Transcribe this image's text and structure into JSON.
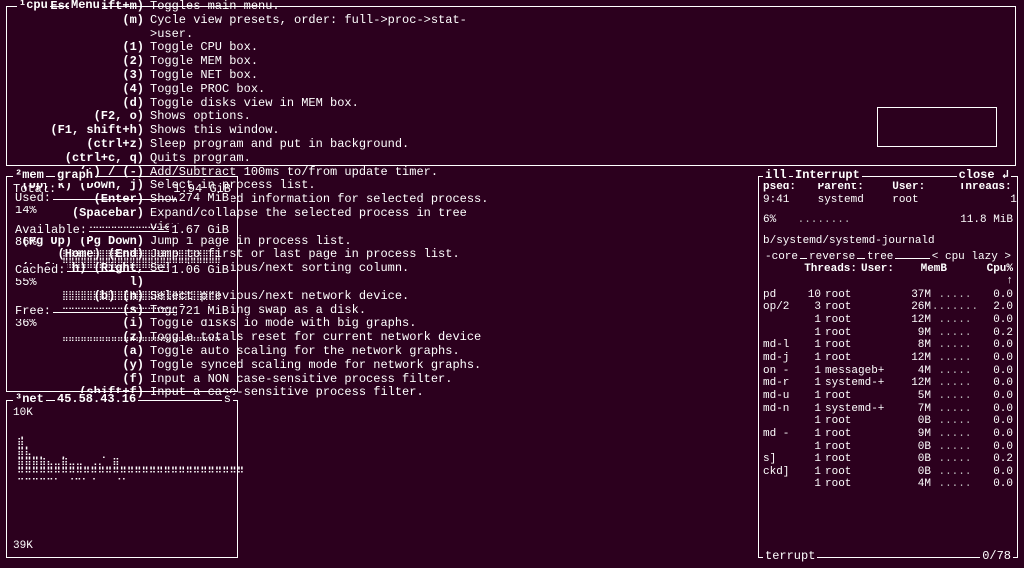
{
  "top": {
    "cpu_tab": "¹cpu",
    "menu": "Menu"
  },
  "mem": {
    "tab": "²mem",
    "view": "graph",
    "total_label": "Total:",
    "total_val": "1.94 GiB",
    "used_label": "Used:",
    "used_val": "274 MiB",
    "used_pct": "14%",
    "avail_label": "Available:",
    "avail_val": "1.67 GiB",
    "avail_pct": "86%",
    "cached_label": "Cached:",
    "cached_val": "1.06 GiB",
    "cached_pct": "55%",
    "free_label": "Free:",
    "free_val": "721 MiB",
    "free_pct": "36%"
  },
  "net": {
    "tab": "³net",
    "iface": "45.58.43.16",
    "up": "10K",
    "down": "39K",
    "side": "s"
  },
  "help": {
    "rows": [
      {
        "k": "(Esc, shift+m)",
        "d": "Toggles main menu."
      },
      {
        "k": "(m)",
        "d": "Cycle view presets, order: full->proc->stat->user."
      },
      {
        "k": "(1)",
        "d": "Toggle CPU box."
      },
      {
        "k": "(2)",
        "d": "Toggle MEM box."
      },
      {
        "k": "(3)",
        "d": "Toggle NET box."
      },
      {
        "k": "(4)",
        "d": "Toggle PROC box."
      },
      {
        "k": "(d)",
        "d": "Toggle disks view in MEM box."
      },
      {
        "k": "(F2, o)",
        "d": "Shows options."
      },
      {
        "k": "(F1, shift+h)",
        "d": "Shows this window."
      },
      {
        "k": "(ctrl+z)",
        "d": "Sleep program and put in background."
      },
      {
        "k": "(ctrl+c, q)",
        "d": "Quits program."
      },
      {
        "k": "(+) / (-)",
        "d": "Add/Subtract 100ms to/from update timer."
      },
      {
        "k": "(Up, k) (Down, j)",
        "d": "Select in process list."
      },
      {
        "k": "(Enter)",
        "d": "Show detailed information for selected process."
      },
      {
        "k": "(Spacebar)",
        "d": "Expand/collapse the selected process in tree view."
      },
      {
        "k": "(Pg Up) (Pg Down)",
        "d": "Jump 1 page in process list."
      },
      {
        "k": "(Home) (End)",
        "d": "Jump to first or last page in process list."
      },
      {
        "k": "(Left, h) (Right, l)",
        "d": "Select previous/next sorting column."
      },
      {
        "k": "(b) (n)",
        "d": "Select previous/next network device."
      },
      {
        "k": "(s)",
        "d": "Toggle showing swap as a disk."
      },
      {
        "k": "(i)",
        "d": "Toggle disks io mode with big graphs."
      },
      {
        "k": "(z)",
        "d": "Toggle totals reset for current network device"
      },
      {
        "k": "(a)",
        "d": "Toggle auto scaling for the network graphs."
      },
      {
        "k": "(y)",
        "d": "Toggle synced scaling mode for network graphs."
      },
      {
        "k": "(f)",
        "d": "Input a NON case-sensitive process filter."
      },
      {
        "k": "(shift+f)",
        "d": "Input a case-sensitive process filter."
      }
    ]
  },
  "proc": {
    "title_left": "ill",
    "title_mid": "Interrupt",
    "title_close": "close ↲",
    "hdr_psed": "psed:",
    "hdr_parent": "Parent:",
    "hdr_user": "User:",
    "hdr_threads": "Threads:",
    "val_psed": "9:41",
    "val_parent": "systemd",
    "val_user": "root",
    "val_threads": "1",
    "cpu_pct": "6%",
    "dots": "........",
    "mem": "11.8 MiB",
    "path": "b/systemd/systemd-journald",
    "sort_core": "-core",
    "sort_reverse": "reverse",
    "sort_tree": "tree",
    "sort_cpu_lazy": "< cpu lazy >",
    "cols": {
      "c1": "",
      "c2": "Threads:",
      "c3": "User:",
      "c4": "MemB",
      "c5": "",
      "c6": "Cpu% ↑"
    },
    "rows": [
      {
        "n": "pd",
        "t": "10",
        "u": "root",
        "m": "37M",
        "g": ".....",
        "c": "0.0"
      },
      {
        "n": "op/2",
        "t": "3",
        "u": "root",
        "m": "26M",
        "g": ".......",
        "c": "2.0"
      },
      {
        "n": "",
        "t": "1",
        "u": "root",
        "m": "12M",
        "g": ".....",
        "c": "0.0"
      },
      {
        "n": "",
        "t": "1",
        "u": "root",
        "m": "9M",
        "g": ".....",
        "c": "0.2"
      },
      {
        "n": "md-l",
        "t": "1",
        "u": "root",
        "m": "8M",
        "g": ".....",
        "c": "0.0"
      },
      {
        "n": "md-j",
        "t": "1",
        "u": "root",
        "m": "12M",
        "g": ".....",
        "c": "0.0"
      },
      {
        "n": "on -",
        "t": "1",
        "u": "messageb+",
        "m": "4M",
        "g": ".....",
        "c": "0.0"
      },
      {
        "n": "md-r",
        "t": "1",
        "u": "systemd-+",
        "m": "12M",
        "g": ".....",
        "c": "0.0"
      },
      {
        "n": "md-u",
        "t": "1",
        "u": "root",
        "m": "5M",
        "g": ".....",
        "c": "0.0"
      },
      {
        "n": "md-n",
        "t": "1",
        "u": "systemd-+",
        "m": "7M",
        "g": ".....",
        "c": "0.0"
      },
      {
        "n": "",
        "t": "1",
        "u": "root",
        "m": "0B",
        "g": ".....",
        "c": "0.0"
      },
      {
        "n": "md -",
        "t": "1",
        "u": "root",
        "m": "9M",
        "g": ".....",
        "c": "0.0"
      },
      {
        "n": "",
        "t": "1",
        "u": "root",
        "m": "0B",
        "g": ".....",
        "c": "0.0"
      },
      {
        "n": "s]",
        "t": "1",
        "u": "root",
        "m": "0B",
        "g": ".....",
        "c": "0.2"
      },
      {
        "n": "ckd]",
        "t": "1",
        "u": "root",
        "m": "0B",
        "g": ".....",
        "c": "0.0"
      },
      {
        "n": "",
        "t": "1",
        "u": "root",
        "m": "4M",
        "g": ".....",
        "c": "0.0"
      }
    ],
    "foot_left": "terrupt",
    "foot_right": "0/78"
  }
}
